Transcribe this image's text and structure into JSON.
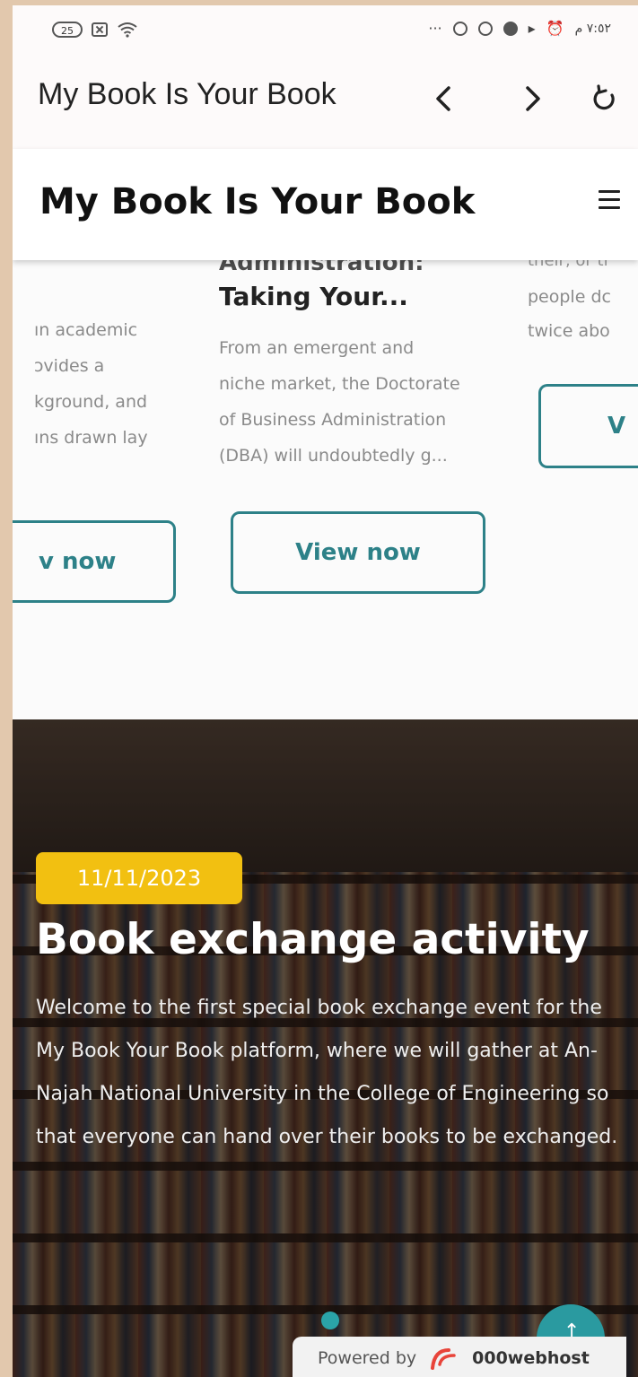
{
  "status_bar": {
    "battery": "25",
    "time": "٧:٥٢ م",
    "more": "···"
  },
  "browser": {
    "title": "My Book Is Your Book"
  },
  "site": {
    "title": "My Book Is Your Book"
  },
  "cards": {
    "left": {
      "text_lines": [
        "ın academic",
        "ɔvides a",
        "kground, and",
        "ıns drawn lay"
      ],
      "button": "v now"
    },
    "middle": {
      "title_cut": "Administration:",
      "title": "Taking Your...",
      "text_lines": [
        "From an emergent and",
        "niche market, the Doctorate",
        "of Business Administration",
        "(DBA) will undoubtedly g..."
      ],
      "button": "View now"
    },
    "right": {
      "cut_line": "their, or tl",
      "text_lines": [
        "people dc",
        "twice abo"
      ],
      "button": "V"
    }
  },
  "event": {
    "date": "11/11/2023",
    "title": "Book exchange activity",
    "description": "Welcome to the first special book exchange event for the My Book Your Book platform, where we will gather at An-Najah National University in the College of Engineering so that everyone can hand over their books to be exchanged."
  },
  "footer": {
    "powered_by": "Powered by",
    "brand": "000webhost",
    "scroll_top_icon": "arrow-up-icon"
  }
}
